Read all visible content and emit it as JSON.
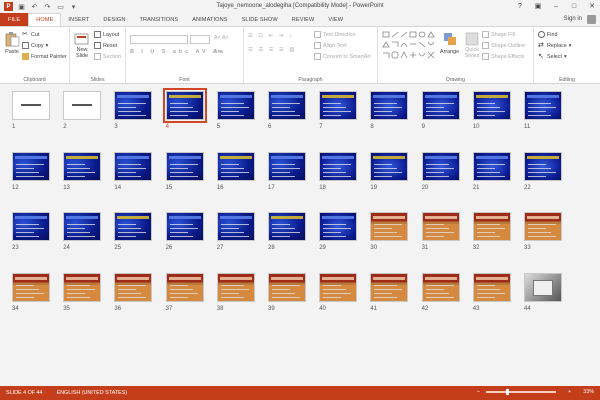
{
  "window": {
    "title": "Tajoye_nemoone_alodegiha [Compatibility Mode] - PowerPoint"
  },
  "qat": [
    "save-icon",
    "undo-icon",
    "redo-icon",
    "start-from-beginning-icon",
    "customize-icon"
  ],
  "tabs": [
    {
      "label": "FILE",
      "kind": "file"
    },
    {
      "label": "HOME",
      "kind": "active"
    },
    {
      "label": "INSERT",
      "kind": "normal"
    },
    {
      "label": "DESIGN",
      "kind": "normal"
    },
    {
      "label": "TRANSITIONS",
      "kind": "normal"
    },
    {
      "label": "ANIMATIONS",
      "kind": "normal"
    },
    {
      "label": "SLIDE SHOW",
      "kind": "normal"
    },
    {
      "label": "REVIEW",
      "kind": "normal"
    },
    {
      "label": "VIEW",
      "kind": "normal"
    }
  ],
  "signin": "Sign in",
  "ribbon": {
    "clipboard": {
      "paste": "Paste",
      "cut": "Cut",
      "copy": "Copy",
      "format_painter": "Format Painter",
      "label": "Clipboard"
    },
    "slides": {
      "new_slide": "New",
      "new_slide2": "Slide",
      "layout": "Layout",
      "reset": "Reset",
      "section": "Section",
      "label": "Slides"
    },
    "font": {
      "label": "Font"
    },
    "paragraph": {
      "text_direction": "Text Direction",
      "align_text": "Align Text",
      "convert_smartart": "Convert to SmartArt",
      "label": "Paragraph"
    },
    "drawing": {
      "arrange": "Arrange",
      "quick_styles": "Quick",
      "quick_styles2": "Styles",
      "shape_fill": "Shape Fill",
      "shape_outline": "Shape Outline",
      "shape_effects": "Shape Effects",
      "label": "Drawing"
    },
    "editing": {
      "find": "Find",
      "replace": "Replace",
      "select": "Select",
      "label": "Editing"
    }
  },
  "slides": [
    {
      "n": "1",
      "bg": "white"
    },
    {
      "n": "2",
      "bg": "white"
    },
    {
      "n": "3",
      "bg": "blue"
    },
    {
      "n": "4",
      "bg": "blue",
      "selected": true
    },
    {
      "n": "5",
      "bg": "blue"
    },
    {
      "n": "6",
      "bg": "blue"
    },
    {
      "n": "7",
      "bg": "blue2"
    },
    {
      "n": "8",
      "bg": "blue2"
    },
    {
      "n": "9",
      "bg": "blue2"
    },
    {
      "n": "10",
      "bg": "blue2"
    },
    {
      "n": "11",
      "bg": "blue2"
    },
    {
      "n": "12",
      "bg": "blue"
    },
    {
      "n": "13",
      "bg": "blue"
    },
    {
      "n": "14",
      "bg": "blue"
    },
    {
      "n": "15",
      "bg": "blue"
    },
    {
      "n": "16",
      "bg": "blue"
    },
    {
      "n": "17",
      "bg": "blue"
    },
    {
      "n": "18",
      "bg": "blue2"
    },
    {
      "n": "19",
      "bg": "blue2"
    },
    {
      "n": "20",
      "bg": "blue2"
    },
    {
      "n": "21",
      "bg": "blue2"
    },
    {
      "n": "22",
      "bg": "blue2"
    },
    {
      "n": "23",
      "bg": "blue"
    },
    {
      "n": "24",
      "bg": "blue"
    },
    {
      "n": "25",
      "bg": "blue"
    },
    {
      "n": "26",
      "bg": "blue"
    },
    {
      "n": "27",
      "bg": "blue"
    },
    {
      "n": "28",
      "bg": "blue"
    },
    {
      "n": "29",
      "bg": "blue2"
    },
    {
      "n": "30",
      "bg": "red"
    },
    {
      "n": "31",
      "bg": "red"
    },
    {
      "n": "32",
      "bg": "red"
    },
    {
      "n": "33",
      "bg": "red"
    },
    {
      "n": "34",
      "bg": "red"
    },
    {
      "n": "35",
      "bg": "red"
    },
    {
      "n": "36",
      "bg": "red"
    },
    {
      "n": "37",
      "bg": "red"
    },
    {
      "n": "38",
      "bg": "red"
    },
    {
      "n": "39",
      "bg": "red"
    },
    {
      "n": "40",
      "bg": "red"
    },
    {
      "n": "41",
      "bg": "red"
    },
    {
      "n": "42",
      "bg": "red"
    },
    {
      "n": "43",
      "bg": "red"
    },
    {
      "n": "44",
      "bg": "photo"
    }
  ],
  "status": {
    "slide_of": "SLIDE 4 OF 44",
    "language": "ENGLISH (UNITED STATES)",
    "zoom": "33%"
  },
  "colors": {
    "accent": "#c43e1c",
    "selection": "#d24726"
  }
}
